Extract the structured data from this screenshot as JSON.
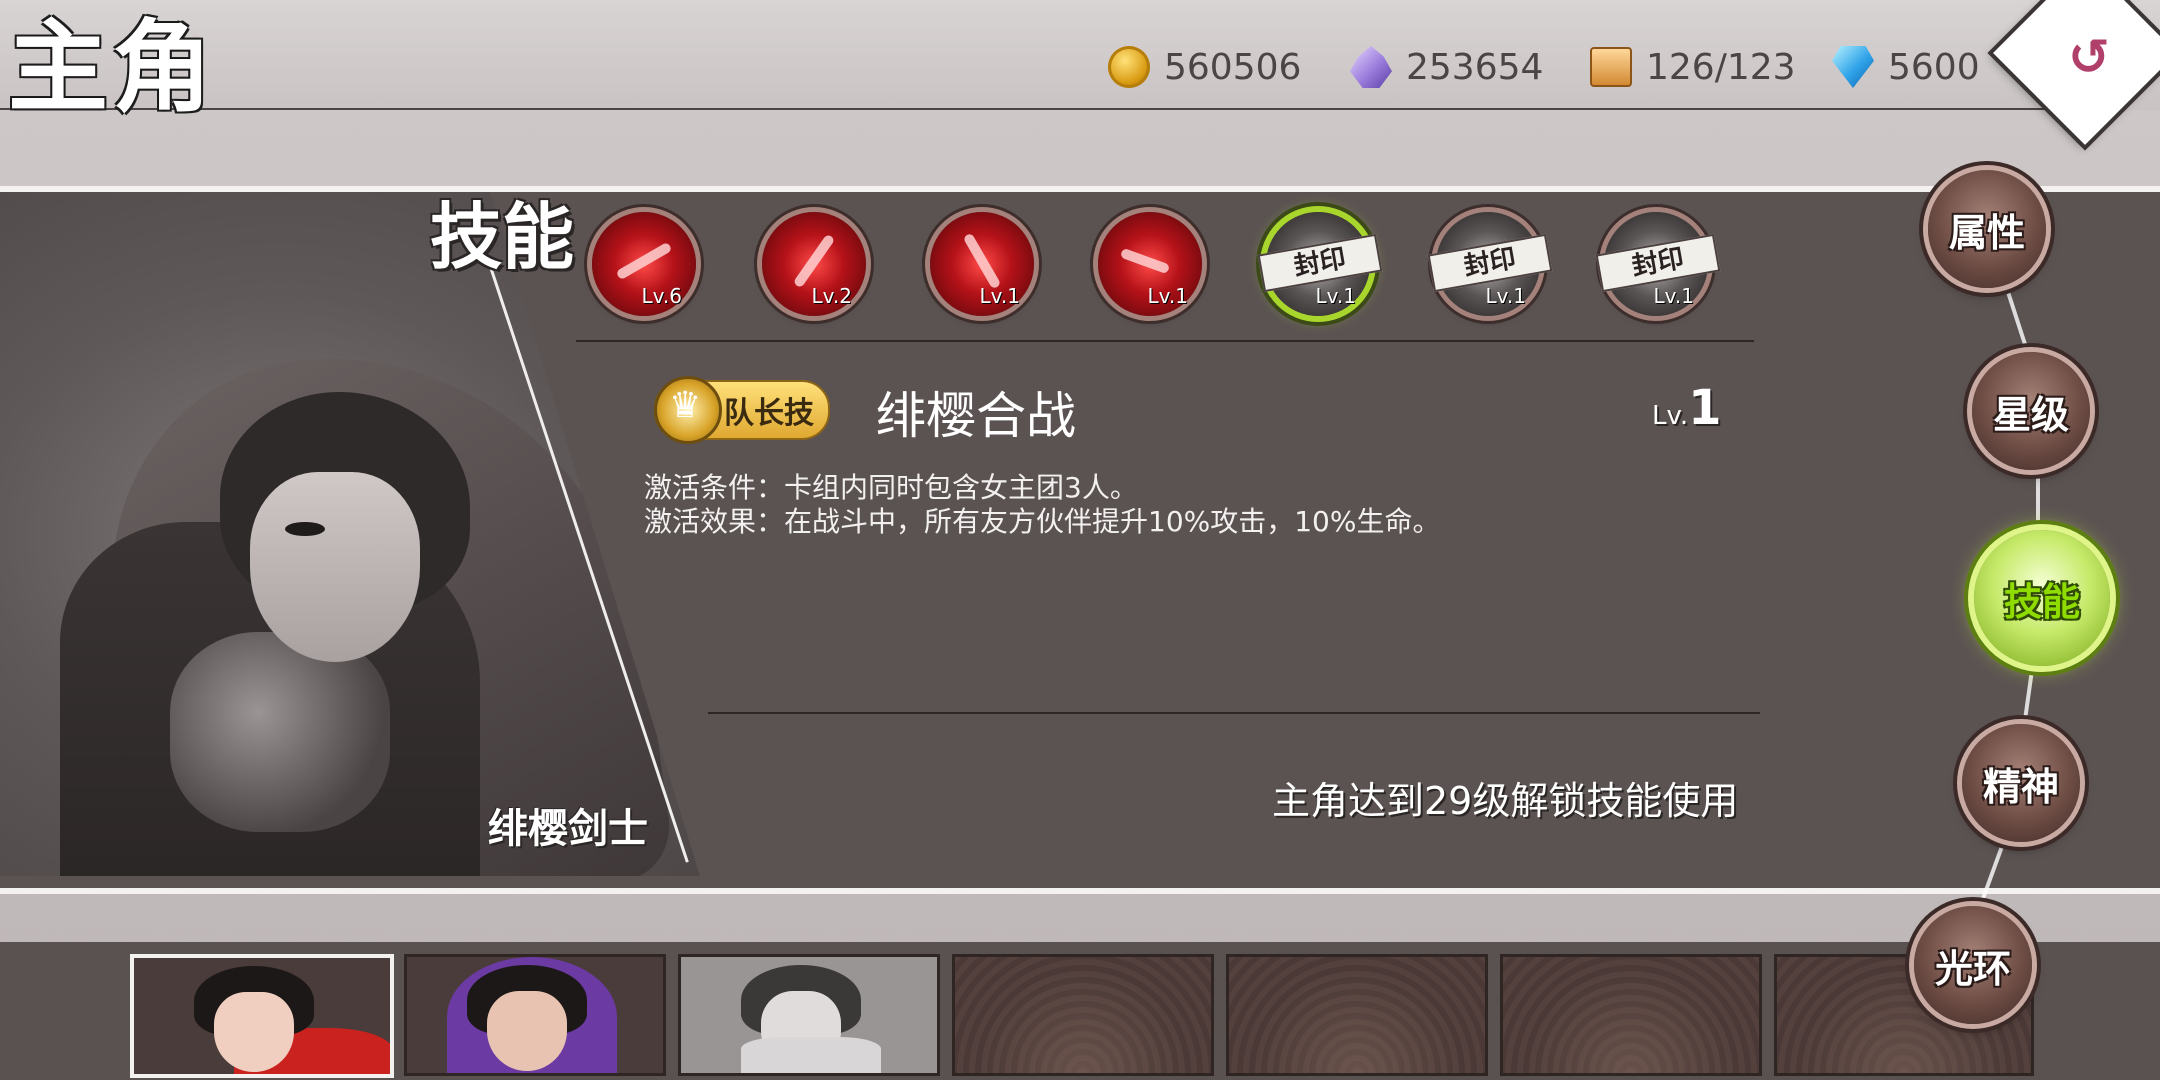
{
  "header": {
    "title": "主角",
    "currencies": [
      {
        "icon": "gold-coin-icon",
        "value": "560506"
      },
      {
        "icon": "crystal-icon",
        "value": "253654"
      },
      {
        "icon": "treasure-box-icon",
        "value": "126/123"
      },
      {
        "icon": "diamond-icon",
        "value": "5600"
      }
    ],
    "back_icon": "↺"
  },
  "character": {
    "name": "绯樱剑士"
  },
  "skills_section": {
    "title": "技能",
    "skills": [
      {
        "icon": "skill-sword-slash-icon",
        "level": "Lv.6",
        "state": "unlocked"
      },
      {
        "icon": "skill-blade-icon",
        "level": "Lv.2",
        "state": "unlocked"
      },
      {
        "icon": "skill-burst-icon",
        "level": "Lv.1",
        "state": "unlocked"
      },
      {
        "icon": "skill-crescent-icon",
        "level": "Lv.1",
        "state": "unlocked"
      },
      {
        "icon": "skill-sealed-icon",
        "level": "Lv.1",
        "state": "sealed",
        "seal_label": "封印",
        "selected": true
      },
      {
        "icon": "skill-sealed-icon",
        "level": "Lv.1",
        "state": "sealed",
        "seal_label": "封印"
      },
      {
        "icon": "skill-sealed-icon",
        "level": "Lv.1",
        "state": "sealed",
        "seal_label": "封印"
      }
    ]
  },
  "skill_detail": {
    "badge_label": "队长技",
    "name": "绯樱合战",
    "level_prefix": "Lv.",
    "level_number": "1",
    "description_lines": [
      "激活条件：卡组内同时包含女主团3人。",
      "激活效果：在战斗中，所有友方伙伴提升10%攻击，10%生命。"
    ],
    "unlock_hint": "主角达到29级解锁技能使用"
  },
  "side_nav": {
    "items": [
      {
        "label": "属性",
        "active": false
      },
      {
        "label": "星级",
        "active": false
      },
      {
        "label": "技能",
        "active": true
      },
      {
        "label": "精神",
        "active": false
      },
      {
        "label": "光环",
        "active": false
      }
    ]
  },
  "roster": {
    "cards": [
      {
        "name": "card-sakura-swordsman",
        "selected": true
      },
      {
        "name": "card-purple-hood",
        "selected": false
      },
      {
        "name": "card-armored-hero",
        "selected": false
      },
      {
        "name": "card-empty",
        "selected": false
      },
      {
        "name": "card-empty",
        "selected": false
      },
      {
        "name": "card-empty",
        "selected": false
      },
      {
        "name": "card-empty",
        "selected": false
      }
    ]
  },
  "colors": {
    "panel_bg": "#5b5352",
    "active_nav": "#a9d62d",
    "skill_red": "#b51219",
    "badge_gold": "#e0a931"
  }
}
